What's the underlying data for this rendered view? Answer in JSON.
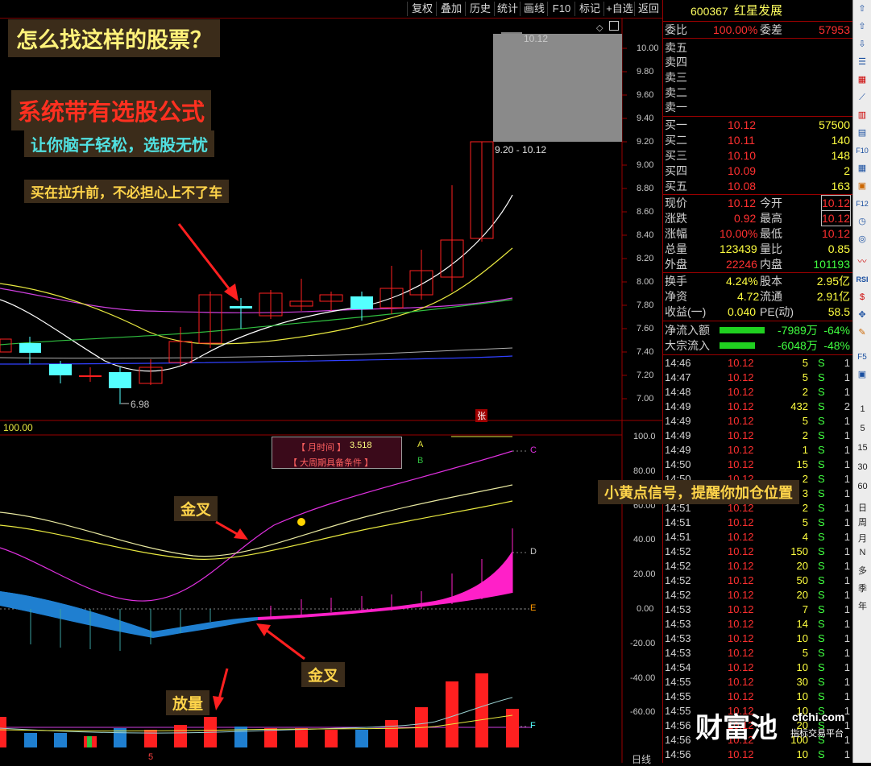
{
  "toolbar": {
    "items": [
      "复权",
      "叠加",
      "历史",
      "统计",
      "画线",
      "F10",
      "标记",
      "+自选",
      "返回"
    ]
  },
  "stock": {
    "code": "600367",
    "name": "红星发展"
  },
  "overlays": {
    "title": "怎么找这样的股票？",
    "system": "系统带有选股公式",
    "easy": "让你脑子轻松，选股无忧",
    "buy": "买在拉升前，不必担心上不了车",
    "gold1": "金叉",
    "gold2": "金叉",
    "volume": "放量",
    "yellow_dot": "小黄点信号，提醒你加仓位置"
  },
  "price_axis": [
    "10.00",
    "9.80",
    "9.60",
    "9.40",
    "9.20",
    "9.00",
    "8.80",
    "8.60",
    "8.40",
    "8.20",
    "8.00",
    "7.80",
    "7.60",
    "7.40",
    "7.20",
    "7.00"
  ],
  "indicator_axis": [
    "100.0",
    "80.00",
    "60.00",
    "40.00",
    "20.00",
    "0.00",
    "-20.00",
    "-40.00",
    "-60.00"
  ],
  "chart_labels": {
    "hi_tag": "10.12",
    "range_tag": "9.20 - 10.12",
    "lo_tag": "6.98",
    "zhang": "张",
    "panel_value": "100.00",
    "line_c": "C",
    "line_d": "D",
    "line_e": "E",
    "line_f": "F",
    "legend_a": "A",
    "legend_b": "B",
    "box_line1": "【 月时间 】",
    "box_value": "3.518",
    "box_line2": "【 大周期具备条件 】",
    "bottom_tick": "5",
    "bottom_right": "日线"
  },
  "order_book": {
    "weibi_label": "委比",
    "weibi": "100.00%",
    "weicha_label": "委差",
    "weicha": "57953",
    "sells": [
      {
        "label": "卖五"
      },
      {
        "label": "卖四"
      },
      {
        "label": "卖三"
      },
      {
        "label": "卖二"
      },
      {
        "label": "卖一"
      }
    ],
    "buys": [
      {
        "label": "买一",
        "price": "10.12",
        "vol": "57500"
      },
      {
        "label": "买二",
        "price": "10.11",
        "vol": "140"
      },
      {
        "label": "买三",
        "price": "10.10",
        "vol": "148"
      },
      {
        "label": "买四",
        "price": "10.09",
        "vol": "2"
      },
      {
        "label": "买五",
        "price": "10.08",
        "vol": "163"
      }
    ]
  },
  "stats": [
    {
      "l1": "现价",
      "v1": "10.12",
      "l2": "今开",
      "v2": "10.12"
    },
    {
      "l1": "涨跌",
      "v1": "0.92",
      "l2": "最高",
      "v2": "10.12"
    },
    {
      "l1": "涨幅",
      "v1": "10.00%",
      "l2": "最低",
      "v2": "10.12"
    },
    {
      "l1": "总量",
      "v1": "123439",
      "l2": "量比",
      "v2": "0.85"
    },
    {
      "l1": "外盘",
      "v1": "22246",
      "l2": "内盘",
      "v2": "101193"
    }
  ],
  "stats2": [
    {
      "l1": "换手",
      "v1": "4.24%",
      "l2": "股本",
      "v2": "2.95亿"
    },
    {
      "l1": "净资",
      "v1": "4.72",
      "l2": "流通",
      "v2": "2.91亿"
    },
    {
      "l1": "收益(一)",
      "v1": "0.040",
      "l2": "PE(动)",
      "v2": "58.5"
    }
  ],
  "flows": [
    {
      "label": "净流入额",
      "value": "-7989万",
      "pct": "-64%"
    },
    {
      "label": "大宗流入",
      "value": "-6048万",
      "pct": "-48%"
    }
  ],
  "ticks": [
    {
      "t": "14:46",
      "p": "10.12",
      "v": "5",
      "s": "S",
      "n": "1"
    },
    {
      "t": "14:47",
      "p": "10.12",
      "v": "5",
      "s": "S",
      "n": "1"
    },
    {
      "t": "14:48",
      "p": "10.12",
      "v": "2",
      "s": "S",
      "n": "1"
    },
    {
      "t": "14:49",
      "p": "10.12",
      "v": "432",
      "s": "S",
      "n": "2"
    },
    {
      "t": "14:49",
      "p": "10.12",
      "v": "5",
      "s": "S",
      "n": "1"
    },
    {
      "t": "14:49",
      "p": "10.12",
      "v": "2",
      "s": "S",
      "n": "1"
    },
    {
      "t": "14:49",
      "p": "10.12",
      "v": "1",
      "s": "S",
      "n": "1"
    },
    {
      "t": "14:50",
      "p": "10.12",
      "v": "15",
      "s": "S",
      "n": "1"
    },
    {
      "t": "14:50",
      "p": "10.12",
      "v": "2",
      "s": "S",
      "n": "1"
    },
    {
      "t": "14:50",
      "p": "10.12",
      "v": "3",
      "s": "S",
      "n": "1"
    },
    {
      "t": "14:51",
      "p": "10.12",
      "v": "2",
      "s": "S",
      "n": "1"
    },
    {
      "t": "14:51",
      "p": "10.12",
      "v": "5",
      "s": "S",
      "n": "1"
    },
    {
      "t": "14:51",
      "p": "10.12",
      "v": "4",
      "s": "S",
      "n": "1"
    },
    {
      "t": "14:52",
      "p": "10.12",
      "v": "150",
      "s": "S",
      "n": "1"
    },
    {
      "t": "14:52",
      "p": "10.12",
      "v": "20",
      "s": "S",
      "n": "1"
    },
    {
      "t": "14:52",
      "p": "10.12",
      "v": "50",
      "s": "S",
      "n": "1"
    },
    {
      "t": "14:52",
      "p": "10.12",
      "v": "20",
      "s": "S",
      "n": "1"
    },
    {
      "t": "14:53",
      "p": "10.12",
      "v": "7",
      "s": "S",
      "n": "1"
    },
    {
      "t": "14:53",
      "p": "10.12",
      "v": "14",
      "s": "S",
      "n": "1"
    },
    {
      "t": "14:53",
      "p": "10.12",
      "v": "10",
      "s": "S",
      "n": "1"
    },
    {
      "t": "14:53",
      "p": "10.12",
      "v": "5",
      "s": "S",
      "n": "1"
    },
    {
      "t": "14:54",
      "p": "10.12",
      "v": "10",
      "s": "S",
      "n": "1"
    },
    {
      "t": "14:55",
      "p": "10.12",
      "v": "30",
      "s": "S",
      "n": "1"
    },
    {
      "t": "14:55",
      "p": "10.12",
      "v": "10",
      "s": "S",
      "n": "1"
    },
    {
      "t": "14:55",
      "p": "10.12",
      "v": "10",
      "s": "S",
      "n": "1"
    },
    {
      "t": "14:56",
      "p": "10.12",
      "v": "20",
      "s": "S",
      "n": "1"
    },
    {
      "t": "14:56",
      "p": "10.12",
      "v": "100",
      "s": "S",
      "n": "1"
    },
    {
      "t": "14:56",
      "p": "10.12",
      "v": "10",
      "s": "S",
      "n": "1"
    }
  ],
  "sidebar_periods": [
    "1",
    "5",
    "15",
    "30",
    "60",
    "日",
    "周",
    "月",
    "N",
    "多",
    "季",
    "年"
  ],
  "watermark": {
    "brand": "财富池",
    "domain": "cfchi.com",
    "tagline": "指标交易平台"
  },
  "colors": {
    "up": "#ff2020",
    "down": "#54ffff",
    "grid": "#9a0000",
    "yellow": "#ffff40",
    "magenta": "#ff20c8",
    "blue": "#1f7fd0"
  }
}
